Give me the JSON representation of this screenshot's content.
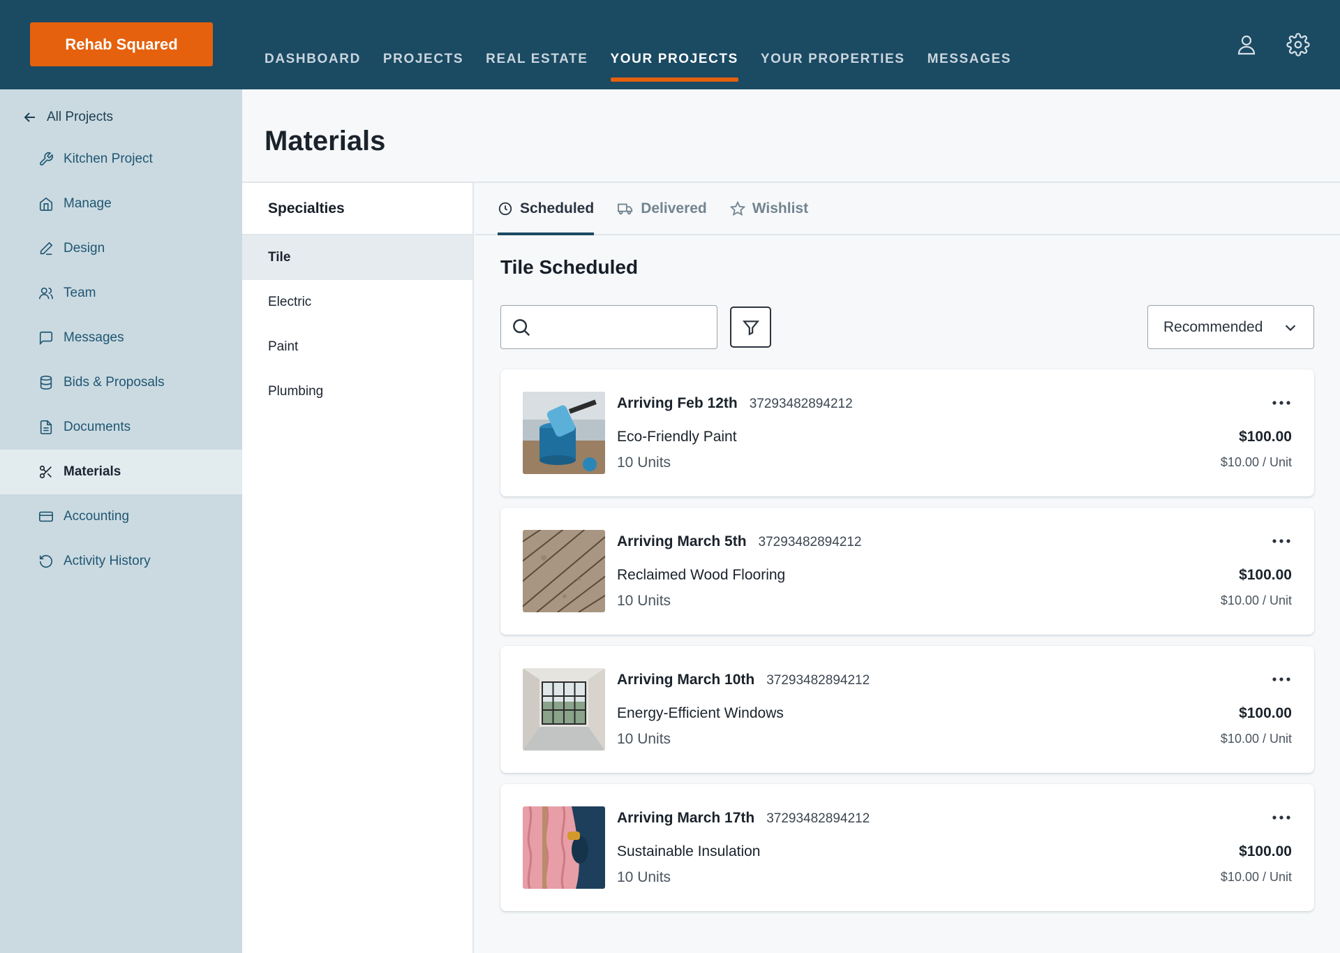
{
  "brand": {
    "label": "Rehab Squared"
  },
  "nav": [
    {
      "label": "DASHBOARD",
      "active": false
    },
    {
      "label": "PROJECTS",
      "active": false
    },
    {
      "label": "REAL ESTATE",
      "active": false
    },
    {
      "label": "YOUR PROJECTS",
      "active": true
    },
    {
      "label": "YOUR PROPERTIES",
      "active": false
    },
    {
      "label": "MESSAGES",
      "active": false
    }
  ],
  "sidebar": {
    "back_label": "All Projects",
    "items": [
      {
        "label": "Kitchen Project",
        "icon": "wrench-icon"
      },
      {
        "label": "Manage",
        "icon": "home-icon"
      },
      {
        "label": "Design",
        "icon": "pencil-icon"
      },
      {
        "label": "Team",
        "icon": "users-icon"
      },
      {
        "label": "Messages",
        "icon": "chat-icon"
      },
      {
        "label": "Bids & Proposals",
        "icon": "database-icon"
      },
      {
        "label": "Documents",
        "icon": "document-icon"
      },
      {
        "label": "Materials",
        "icon": "scissors-icon",
        "active": true
      },
      {
        "label": "Accounting",
        "icon": "credit-card-icon"
      },
      {
        "label": "Activity History",
        "icon": "history-icon"
      }
    ]
  },
  "page": {
    "title": "Materials"
  },
  "specialties": {
    "heading": "Specialties",
    "items": [
      {
        "label": "Tile",
        "active": true
      },
      {
        "label": "Electric"
      },
      {
        "label": "Paint"
      },
      {
        "label": "Plumbing"
      }
    ]
  },
  "tabs": [
    {
      "label": "Scheduled",
      "icon": "clock-icon",
      "active": true
    },
    {
      "label": "Delivered",
      "icon": "truck-icon"
    },
    {
      "label": "Wishlist",
      "icon": "star-icon"
    }
  ],
  "section": {
    "title": "Tile Scheduled"
  },
  "search": {
    "placeholder": "",
    "value": ""
  },
  "sort": {
    "selected": "Recommended"
  },
  "materials": [
    {
      "arrival": "Arriving Feb 12th",
      "order_no": "37293482894212",
      "name": "Eco-Friendly Paint",
      "units": "10 Units",
      "total": "$100.00",
      "unit_price": "$10.00 / Unit",
      "image": "paint-can-image"
    },
    {
      "arrival": "Arriving March 5th",
      "order_no": "37293482894212",
      "name": "Reclaimed Wood Flooring",
      "units": "10 Units",
      "total": "$100.00",
      "unit_price": "$10.00 / Unit",
      "image": "wood-floor-image"
    },
    {
      "arrival": "Arriving March 10th",
      "order_no": "37293482894212",
      "name": "Energy-Efficient Windows",
      "units": "10 Units",
      "total": "$100.00",
      "unit_price": "$10.00 / Unit",
      "image": "window-image"
    },
    {
      "arrival": "Arriving March 17th",
      "order_no": "37293482894212",
      "name": "Sustainable Insulation",
      "units": "10 Units",
      "total": "$100.00",
      "unit_price": "$10.00 / Unit",
      "image": "insulation-image"
    }
  ],
  "colors": {
    "topbar": "#1b4a63",
    "brand": "#e5610d",
    "sidebar": "#cbdae1",
    "accent": "#1b4a63"
  }
}
